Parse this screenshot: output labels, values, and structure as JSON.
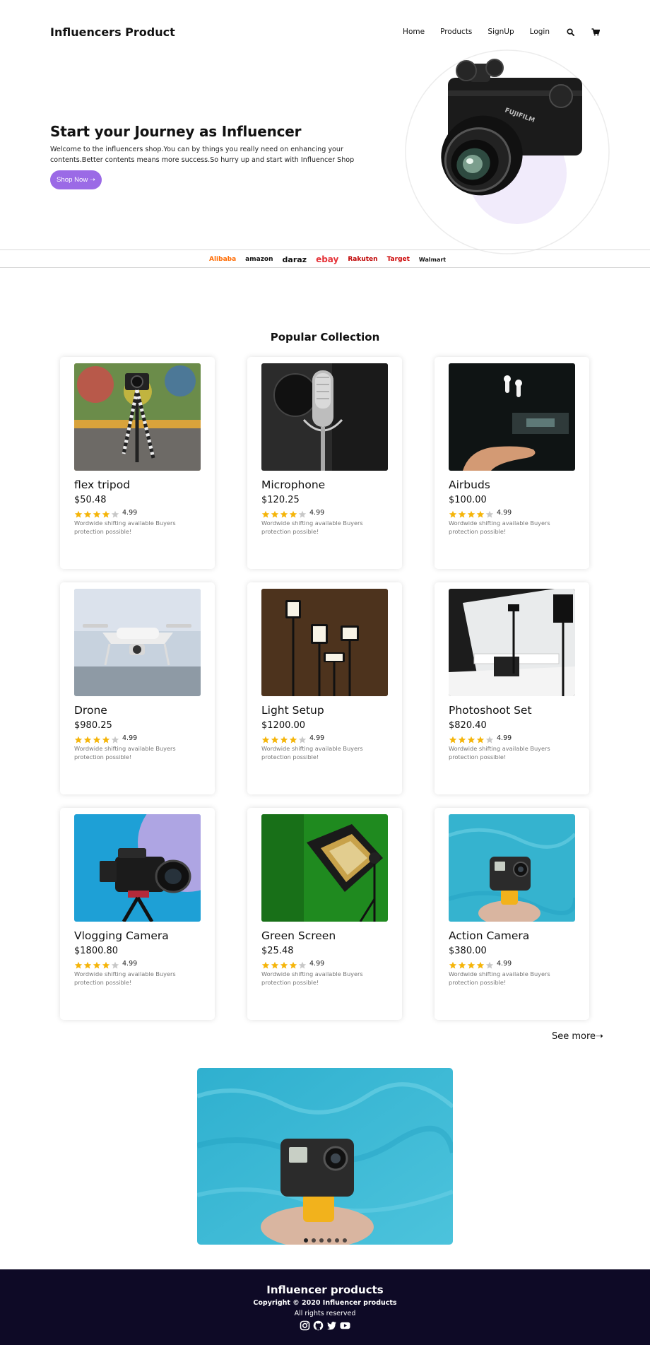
{
  "nav": {
    "brand": "Influencers Product",
    "links": [
      "Home",
      "Products",
      "SignUp",
      "Login"
    ]
  },
  "hero": {
    "title": "Start your Journey as Influencer",
    "description": "Welcome to the influencers shop.You can by things you really need on enhancing your contents.Better contents means more success.So hurry up and start with Influencer Shop",
    "button": "Shop Now ➝"
  },
  "partners": [
    "Alibaba",
    "amazon",
    "daraz",
    "ebay",
    "Rakuten",
    "Target",
    "Walmart"
  ],
  "popular": {
    "title": "Popular Collection",
    "products": [
      {
        "name": "flex tripod",
        "price": "$50.48",
        "rating": "4.99",
        "stars": 4,
        "desc": "Wordwide shifting available Buyers protection possible!"
      },
      {
        "name": "Microphone",
        "price": "$120.25",
        "rating": "4.99",
        "stars": 4,
        "desc": "Wordwide shifting available Buyers protection possible!"
      },
      {
        "name": "Airbuds",
        "price": "$100.00",
        "rating": "4.99",
        "stars": 4,
        "desc": "Wordwide shifting available Buyers protection possible!"
      },
      {
        "name": "Drone",
        "price": "$980.25",
        "rating": "4.99",
        "stars": 4,
        "desc": "Wordwide shifting available Buyers protection possible!"
      },
      {
        "name": "Light Setup",
        "price": "$1200.00",
        "rating": "4.99",
        "stars": 4,
        "desc": "Wordwide shifting available Buyers protection possible!"
      },
      {
        "name": "Photoshoot Set",
        "price": "$820.40",
        "rating": "4.99",
        "stars": 4,
        "desc": "Wordwide shifting available Buyers protection possible!"
      },
      {
        "name": "Vlogging Camera",
        "price": "$1800.80",
        "rating": "4.99",
        "stars": 4,
        "desc": "Wordwide shifting available Buyers protection possible!"
      },
      {
        "name": "Green Screen",
        "price": "$25.48",
        "rating": "4.99",
        "stars": 4,
        "desc": "Wordwide shifting available Buyers protection possible!"
      },
      {
        "name": "Action Camera",
        "price": "$380.00",
        "rating": "4.99",
        "stars": 4,
        "desc": "Wordwide shifting available Buyers protection possible!"
      }
    ],
    "see_more": "See more➝"
  },
  "carousel": {
    "slides": 6,
    "active": 0
  },
  "footer": {
    "title": "Influencer products",
    "copyright": "Copyright © 2020 Influencer products",
    "rights": "All rights reserved",
    "social": [
      "instagram-icon",
      "github-icon",
      "twitter-icon",
      "youtube-icon"
    ]
  },
  "colors": {
    "accent": "#9b6ae6",
    "footer_bg": "#0e0a26",
    "star": "#f5b50a",
    "star_empty": "#c8c8c8"
  }
}
